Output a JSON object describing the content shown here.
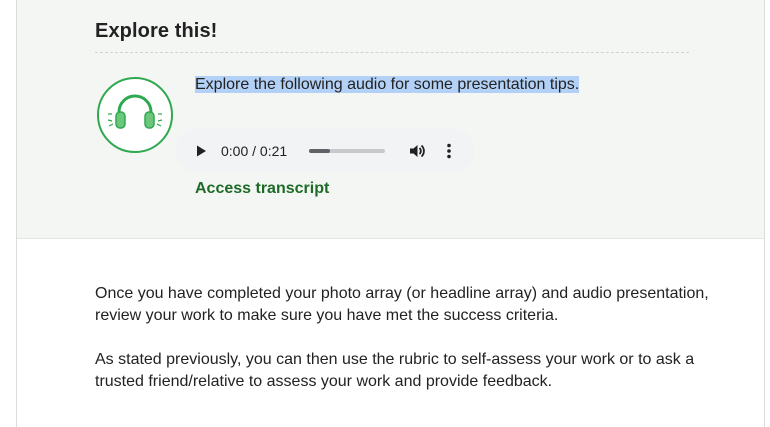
{
  "explore": {
    "title": "Explore this!",
    "intro": "Explore the following audio for some presentation tips.",
    "icon": "headphones-icon",
    "accent_color": "#2fa84f"
  },
  "audio_player": {
    "time": "0:00 / 0:21",
    "progress": 0.28,
    "play_icon": "play-icon",
    "volume_icon": "volume-icon",
    "more_icon": "more-options-icon"
  },
  "transcript": {
    "label": "Access transcript"
  },
  "body": {
    "paragraph_1": "Once you have completed your photo array (or headline array) and audio presentation, review your work to make sure you have met the success criteria.",
    "paragraph_2": "As stated previously, you can then use the rubric to self-assess your work or to ask a trusted friend/relative to assess your work and provide feedback."
  }
}
